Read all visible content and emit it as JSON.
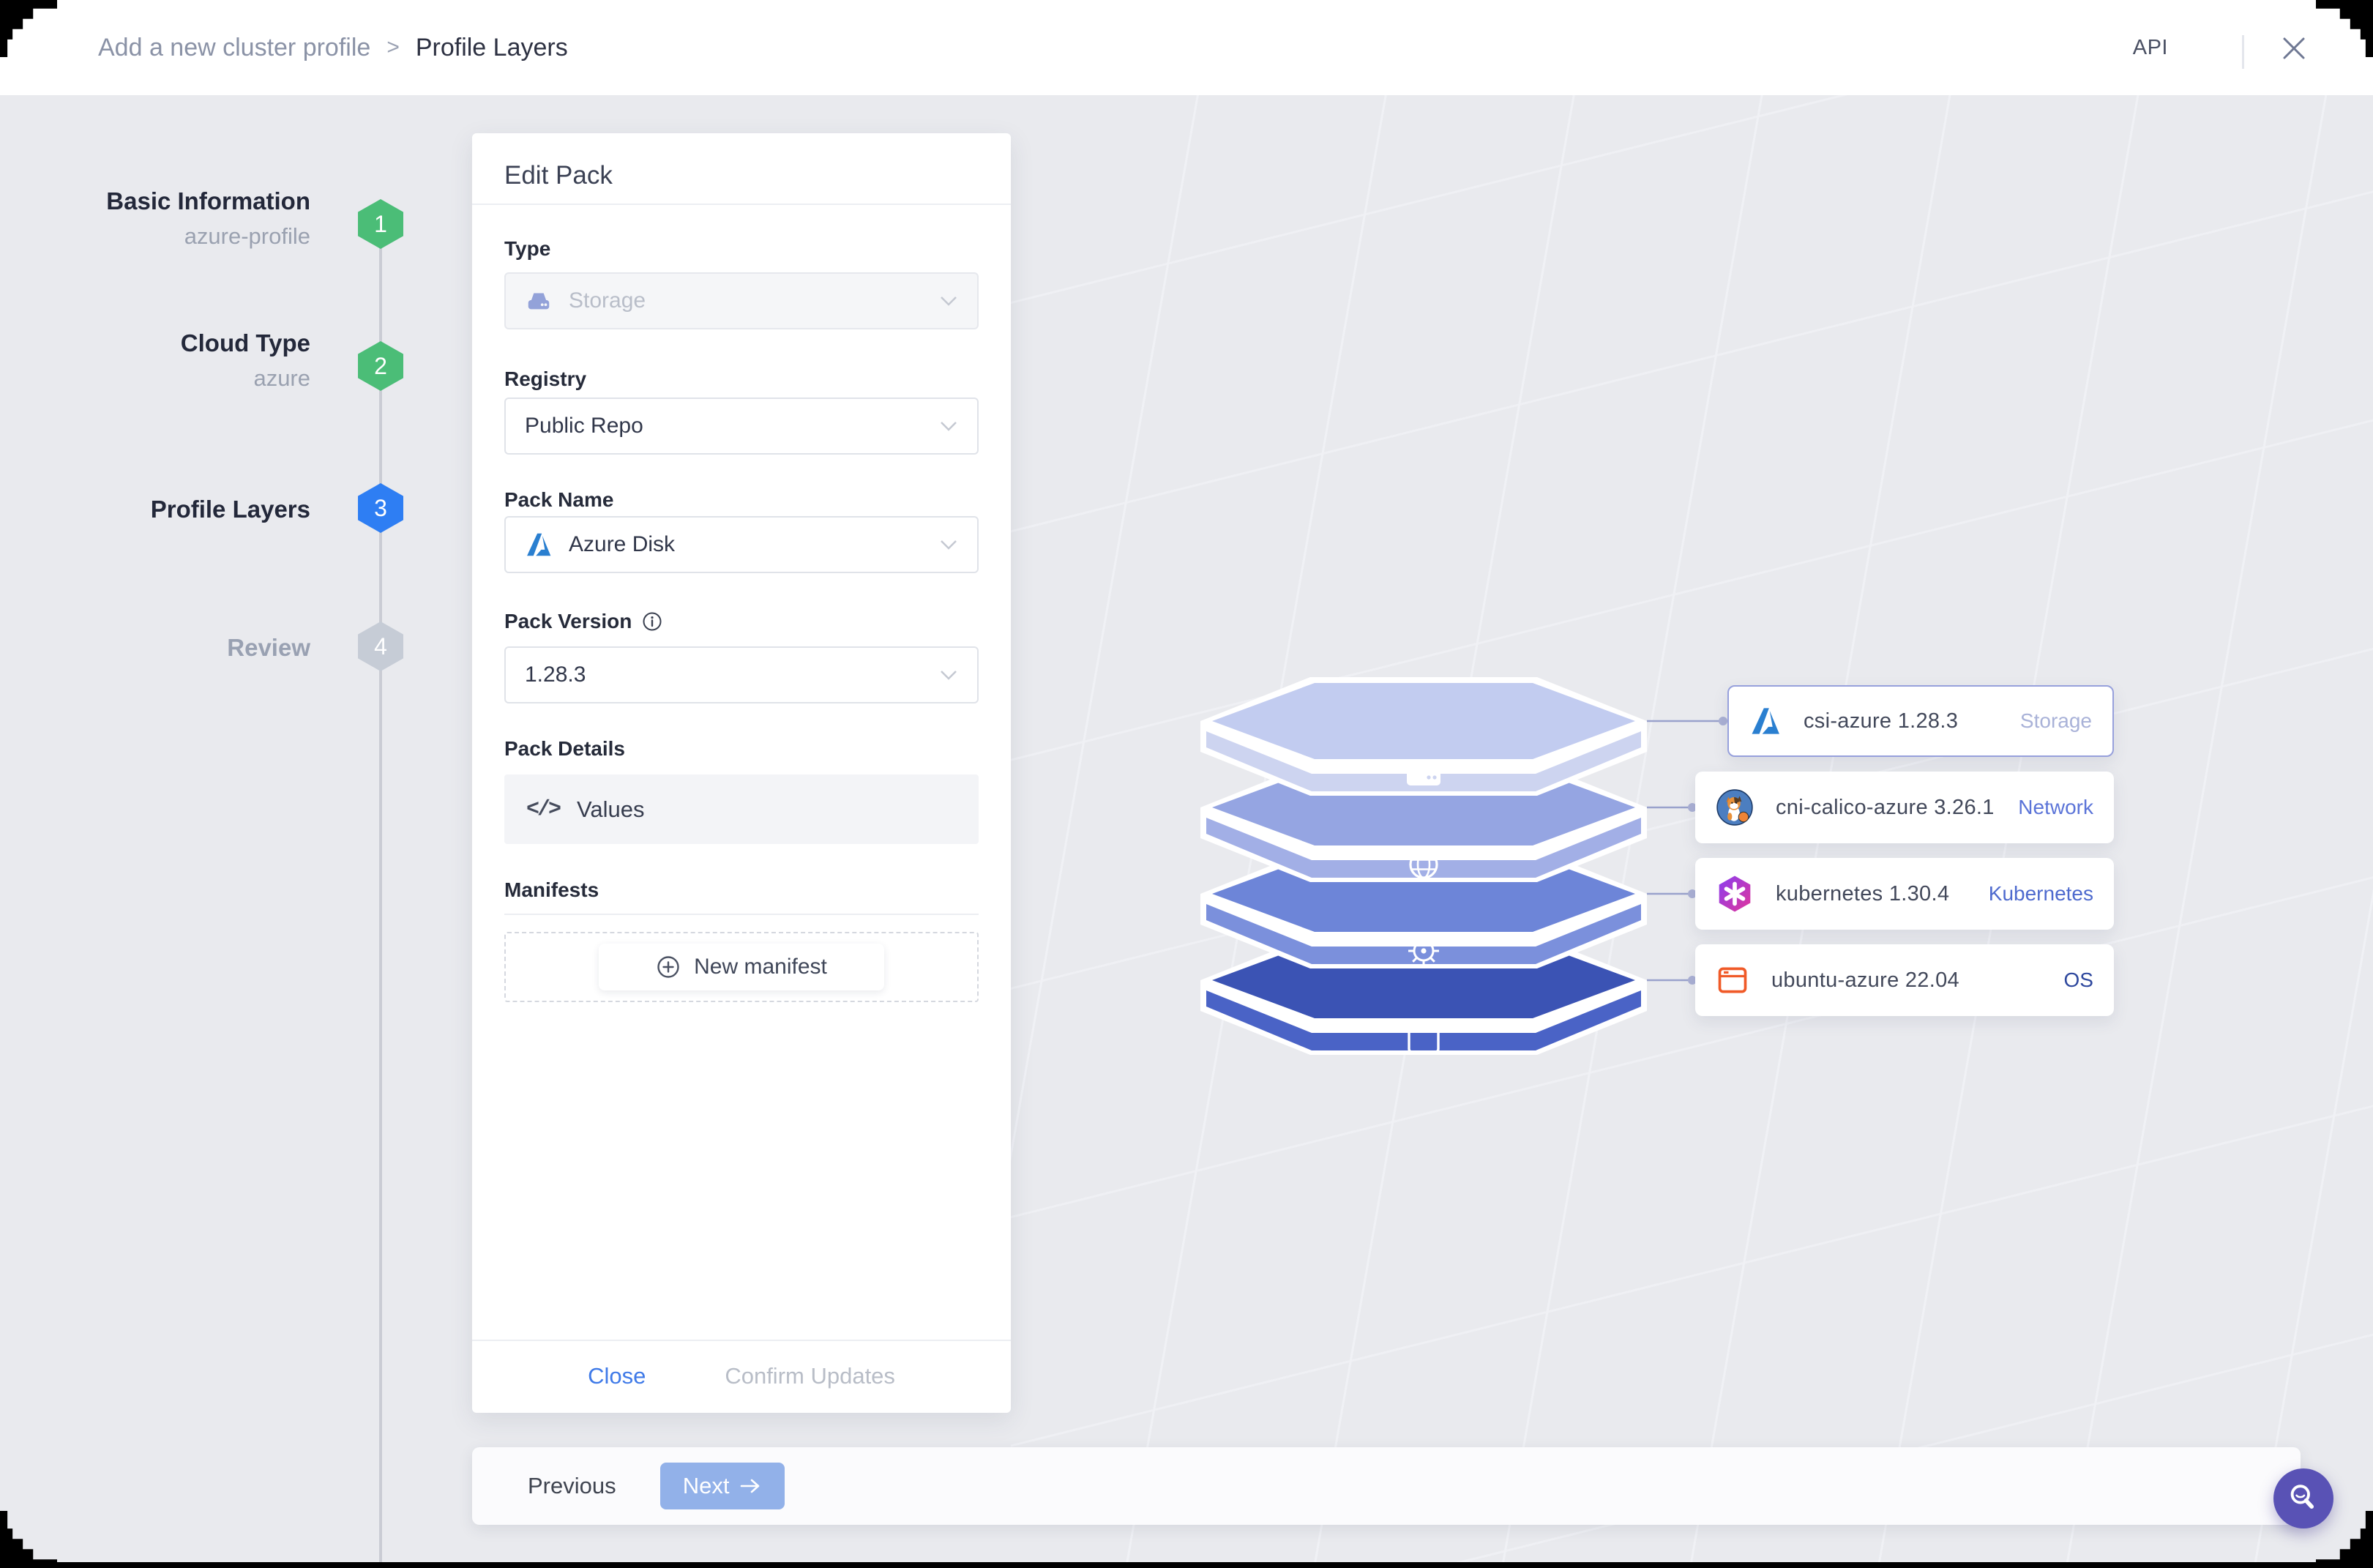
{
  "header": {
    "breadcrumb": {
      "parent": "Add a new cluster profile",
      "separator": ">",
      "current": "Profile Layers"
    },
    "api_label": "API"
  },
  "stepper": {
    "steps": [
      {
        "number": "1",
        "title": "Basic Information",
        "subtitle": "azure-profile",
        "state": "complete"
      },
      {
        "number": "2",
        "title": "Cloud Type",
        "subtitle": "azure",
        "state": "complete"
      },
      {
        "number": "3",
        "title": "Profile Layers",
        "subtitle": "",
        "state": "active"
      },
      {
        "number": "4",
        "title": "Review",
        "subtitle": "",
        "state": "upcoming"
      }
    ]
  },
  "edit_pack": {
    "title": "Edit Pack",
    "type": {
      "label": "Type",
      "value": "Storage",
      "disabled": true,
      "icon": "drive-icon"
    },
    "registry": {
      "label": "Registry",
      "value": "Public Repo"
    },
    "pack_name": {
      "label": "Pack Name",
      "value": "Azure Disk",
      "icon": "azure-logo-icon"
    },
    "pack_version": {
      "label": "Pack Version",
      "value": "1.28.3",
      "info_icon": "info-icon"
    },
    "pack_details": {
      "label": "Pack Details",
      "values_label": "Values",
      "icon": "code-icon"
    },
    "manifests": {
      "label": "Manifests",
      "new_manifest_label": "New manifest",
      "icon": "plus-circle-icon"
    },
    "footer": {
      "close_label": "Close",
      "confirm_label": "Confirm Updates"
    }
  },
  "profile_layers": {
    "cards": [
      {
        "name": "csi-azure 1.28.3",
        "category": "Storage",
        "icon": "azure-logo-icon",
        "selected": true
      },
      {
        "name": "cni-calico-azure 3.26.1",
        "category": "Network",
        "icon": "calico-cat-icon",
        "selected": false
      },
      {
        "name": "kubernetes 1.30.4",
        "category": "Kubernetes",
        "icon": "kubernetes-hex-icon",
        "selected": false
      },
      {
        "name": "ubuntu-azure 22.04",
        "category": "OS",
        "icon": "os-window-icon",
        "selected": false
      }
    ],
    "stack_layer_icons": [
      "storage-drive-icon",
      "network-globe-icon",
      "kubernetes-wheel-icon",
      "os-window-icon"
    ]
  },
  "bottom_bar": {
    "previous_label": "Previous",
    "next_label": "Next"
  },
  "colors": {
    "step_complete": "#4bbd77",
    "step_active": "#2e7ef3",
    "step_upcoming": "#c6ccd6",
    "accent_blue": "#3f7ae8",
    "next_button": "#92b1e9",
    "fab_purple": "#5952b5",
    "layer_top_1": "#c2ccf0",
    "layer_top_2": "#95a5e2",
    "layer_top_3": "#6d85d8",
    "layer_top_4": "#3b53b4",
    "tag_storage": "#a9b2d8",
    "tag_network": "#5b74d8",
    "tag_kubernetes": "#4e6ace",
    "tag_os": "#2e489e"
  }
}
